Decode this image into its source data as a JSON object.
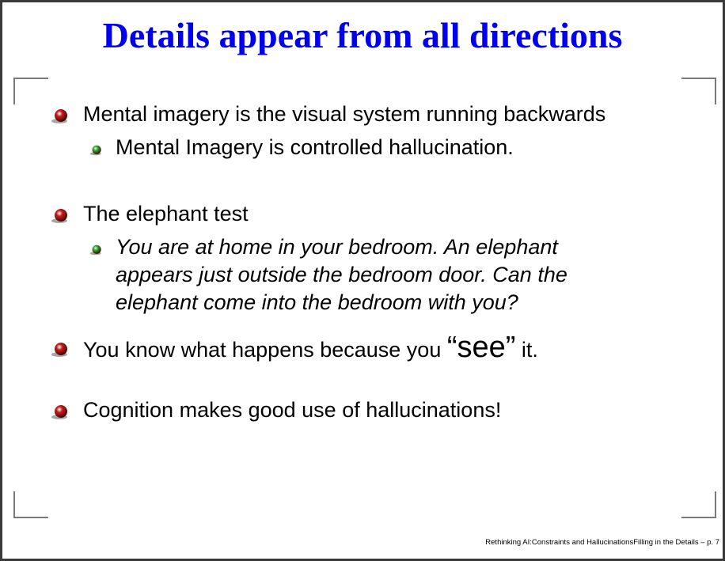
{
  "slide": {
    "title": "Details appear from all directions",
    "title_color": "#0000ee",
    "bullets": [
      {
        "text": "Mental imagery is the visual system running backwards",
        "sub": [
          {
            "text": "Mental Imagery is controlled hallucination."
          }
        ]
      },
      {
        "text": "The elephant test",
        "sub": [
          {
            "lines": [
              "You are at home in your bedroom. An elephant",
              "appears just outside the bedroom door. Can the",
              "elephant come into the bedroom with you?"
            ]
          }
        ]
      },
      {
        "text_before": "You know what happens because you ",
        "emphasis": "“see”",
        "text_after": " it."
      },
      {
        "text": "Cognition makes good use of hallucinations!"
      }
    ],
    "footer": "Rethinking AI:Constraints and HallucinationsFilling in the Details – p. 7",
    "bullet_colors": {
      "primary": "#cc1a1a",
      "secondary": "#2fb52f"
    }
  }
}
